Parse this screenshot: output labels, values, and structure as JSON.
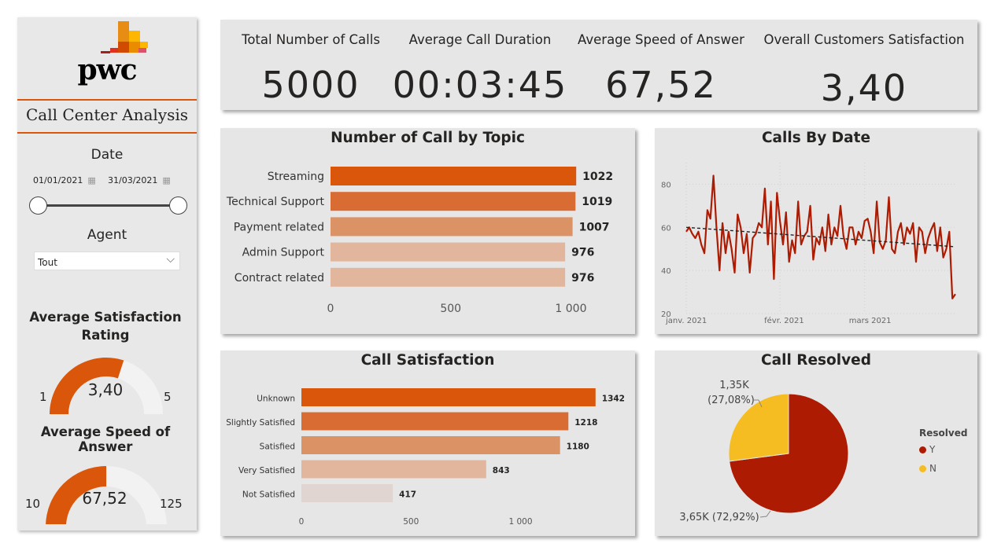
{
  "sidebar": {
    "logo_text": "pwc",
    "title": "Call Center Analysis",
    "date_label": "Date",
    "date_start": "01/01/2021",
    "date_end": "31/03/2021",
    "agent_label": "Agent",
    "agent_value": "Tout",
    "gauge1": {
      "title_line1": "Average Satisfaction",
      "title_line2": "Rating",
      "value": 3.4,
      "value_label": "3,40",
      "min": 1,
      "max": 5,
      "min_label": "1",
      "max_label": "5"
    },
    "gauge2": {
      "title": "Average Speed of Answer",
      "value": 67.52,
      "value_label": "67,52",
      "min": 10,
      "max": 125,
      "min_label": "10",
      "max_label": "125"
    }
  },
  "kpis": [
    {
      "label": "Total Number of Calls",
      "value": "5000"
    },
    {
      "label": "Average Call Duration",
      "value": "00:03:45"
    },
    {
      "label": "Average Speed of Answer",
      "value": "67,52"
    },
    {
      "label": "Overall Customers Satisfaction",
      "value": "3,40"
    }
  ],
  "colors": {
    "orange": "#d9560a",
    "dark_red": "#ad1c02",
    "yellow": "#f5bd22"
  },
  "chart_data": [
    {
      "type": "bar",
      "orientation": "horizontal",
      "title": "Number of Call by Topic",
      "categories": [
        "Streaming",
        "Technical Support",
        "Payment related",
        "Admin Support",
        "Contract related"
      ],
      "values": [
        1022,
        1019,
        1007,
        976,
        976
      ],
      "data_labels": [
        "1022",
        "1019",
        "1007",
        "976",
        "976"
      ],
      "colors": [
        "#d9560a",
        "#d96c33",
        "#db9365",
        "#e2b69d",
        "#e2b69d"
      ],
      "xlim": [
        0,
        1100
      ],
      "xticks": [
        0,
        500,
        1000
      ],
      "xtick_labels": [
        "0",
        "500",
        "1 000"
      ]
    },
    {
      "type": "line",
      "title": "Calls By Date",
      "xtick_labels": [
        "janv. 2021",
        "févr. 2021",
        "mars 2021"
      ],
      "ylim": [
        20,
        90
      ],
      "yticks": [
        20,
        40,
        60,
        80
      ],
      "x": [
        "2021-01-01",
        "2021-01-02",
        "2021-01-03",
        "2021-01-04",
        "2021-01-05",
        "2021-01-06",
        "2021-01-07",
        "2021-01-08",
        "2021-01-09",
        "2021-01-10",
        "2021-01-11",
        "2021-01-12",
        "2021-01-13",
        "2021-01-14",
        "2021-01-15",
        "2021-01-16",
        "2021-01-17",
        "2021-01-18",
        "2021-01-19",
        "2021-01-20",
        "2021-01-21",
        "2021-01-22",
        "2021-01-23",
        "2021-01-24",
        "2021-01-25",
        "2021-01-26",
        "2021-01-27",
        "2021-01-28",
        "2021-01-29",
        "2021-01-30",
        "2021-01-31",
        "2021-02-01",
        "2021-02-02",
        "2021-02-03",
        "2021-02-04",
        "2021-02-05",
        "2021-02-06",
        "2021-02-07",
        "2021-02-08",
        "2021-02-09",
        "2021-02-10",
        "2021-02-11",
        "2021-02-12",
        "2021-02-13",
        "2021-02-14",
        "2021-02-15",
        "2021-02-16",
        "2021-02-17",
        "2021-02-18",
        "2021-02-19",
        "2021-02-20",
        "2021-02-21",
        "2021-02-22",
        "2021-02-23",
        "2021-02-24",
        "2021-02-25",
        "2021-02-26",
        "2021-02-27",
        "2021-02-28",
        "2021-03-01",
        "2021-03-02",
        "2021-03-03",
        "2021-03-04",
        "2021-03-05",
        "2021-03-06",
        "2021-03-07",
        "2021-03-08",
        "2021-03-09",
        "2021-03-10",
        "2021-03-11",
        "2021-03-12",
        "2021-03-13",
        "2021-03-14",
        "2021-03-15",
        "2021-03-16",
        "2021-03-17",
        "2021-03-18",
        "2021-03-19",
        "2021-03-20",
        "2021-03-21",
        "2021-03-22",
        "2021-03-23",
        "2021-03-24",
        "2021-03-25",
        "2021-03-26",
        "2021-03-27",
        "2021-03-28",
        "2021-03-29",
        "2021-03-30",
        "2021-03-31"
      ],
      "series": [
        {
          "values": [
            58,
            60,
            57,
            55,
            58,
            52,
            48,
            68,
            64,
            84,
            60,
            40,
            62,
            48,
            58,
            50,
            39,
            66,
            60,
            48,
            57,
            39,
            55,
            57,
            62,
            60,
            78,
            52,
            72,
            36,
            76,
            63,
            52,
            67,
            44,
            54,
            48,
            72,
            52,
            56,
            58,
            70,
            45,
            55,
            52,
            60,
            49,
            66,
            52,
            60,
            56,
            70,
            56,
            50,
            60,
            60,
            52,
            58,
            55,
            63,
            64,
            58,
            48,
            72,
            53,
            50,
            54,
            74,
            50,
            48,
            58,
            62,
            52,
            60,
            57,
            62,
            44,
            60,
            58,
            48,
            55,
            59,
            62,
            49,
            60,
            46,
            50,
            58,
            27,
            29
          ]
        },
        {
          "name": "trend",
          "style": "dashed",
          "values_endpoints": [
            60,
            51
          ]
        }
      ]
    },
    {
      "type": "bar",
      "orientation": "horizontal",
      "title": "Call Satisfaction",
      "categories": [
        "Unknown",
        "Slightly Satisfied",
        "Satisfied",
        "Very Satisfied",
        "Not Satisfied"
      ],
      "values": [
        1342,
        1218,
        1180,
        843,
        417
      ],
      "data_labels": [
        "1342",
        "1218",
        "1180",
        "843",
        "417"
      ],
      "colors": [
        "#d9560a",
        "#d96c33",
        "#db9365",
        "#e2b69d",
        "#e1d5d1"
      ],
      "xlim": [
        0,
        1350
      ],
      "xticks": [
        0,
        500,
        1000
      ],
      "xtick_labels": [
        "0",
        "500",
        "1 000"
      ]
    },
    {
      "type": "pie",
      "title": "Call Resolved",
      "legend_title": "Resolved",
      "slices": [
        {
          "label": "Y",
          "value": 3646,
          "display": "3,65K (72,92%)",
          "color": "#ad1c02"
        },
        {
          "label": "N",
          "value": 1354,
          "display_line1": "1,35K",
          "display_line2": "(27,08%)",
          "color": "#f5bd22"
        }
      ]
    }
  ]
}
